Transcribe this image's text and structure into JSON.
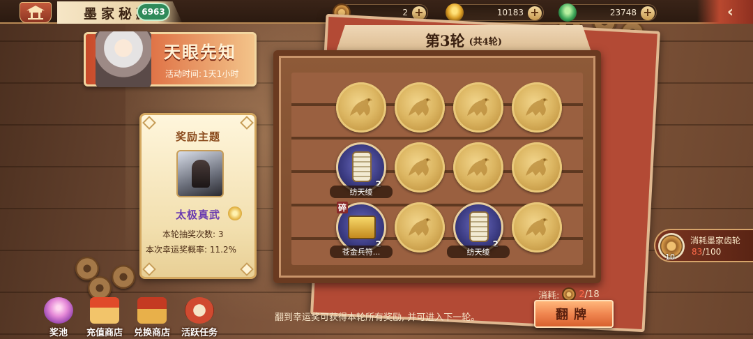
{
  "topbar": {
    "title": "墨家秘藏",
    "badge": "6963",
    "resources": [
      {
        "name": "gear-token",
        "value": "2"
      },
      {
        "name": "gold-ingot",
        "value": "10183"
      },
      {
        "name": "jade-ingot",
        "value": "23748"
      }
    ],
    "back_glyph": "‹"
  },
  "event": {
    "title": "天眼先知",
    "time_label": "活动时间:",
    "time_value": "1天1小时"
  },
  "reward_card": {
    "title": "奖励主题",
    "hero_name": "太极真武",
    "draw_count": "本轮抽奖次数: 3",
    "luck_rate": "本次幸运奖概率: 11.2%"
  },
  "board": {
    "round": "第3轮",
    "total": "(共4轮)",
    "cells": [
      {
        "type": "coin"
      },
      {
        "type": "coin"
      },
      {
        "type": "coin"
      },
      {
        "type": "coin"
      },
      {
        "type": "item",
        "name": "纺天绫",
        "count": "2"
      },
      {
        "type": "coin"
      },
      {
        "type": "coin"
      },
      {
        "type": "coin"
      },
      {
        "type": "item",
        "name": "苍金兵符...",
        "count": "2",
        "frag": "碎"
      },
      {
        "type": "coin"
      },
      {
        "type": "item",
        "name": "纺天绫",
        "count": "2"
      },
      {
        "type": "coin"
      }
    ]
  },
  "consume_panel": {
    "title": "消耗墨家齿轮",
    "icon_count": "10",
    "current": "83",
    "max": "/100"
  },
  "bottom_nav": [
    {
      "label": "奖池",
      "icon": "prize-pool-icon"
    },
    {
      "label": "充值商店",
      "icon": "recharge-shop-icon"
    },
    {
      "label": "兑换商店",
      "icon": "exchange-shop-icon"
    },
    {
      "label": "活跃任务",
      "icon": "active-task-icon"
    }
  ],
  "hint": "翻到幸运奖可获得本轮所有奖励, 并可进入下一轮。",
  "cost": {
    "label": "消耗:",
    "have": "2",
    "need": "/18"
  },
  "flip_button": "翻牌"
}
